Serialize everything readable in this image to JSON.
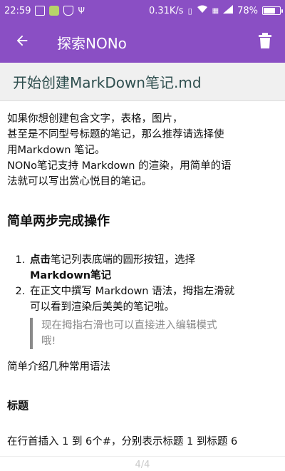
{
  "status_bar": {
    "time": "22:59",
    "speed": "0.31K/s",
    "battery_percent": "78%",
    "battery_level": 0.78
  },
  "app_bar": {
    "title": "探索NONo"
  },
  "file": {
    "title": "开始创建MarkDown笔记.md"
  },
  "content": {
    "intro_lines": [
      "如果你想创建包含文字，表格，图片，",
      "甚至是不同型号标题的笔记，那么推荐请选择使",
      "用Markdown 笔记。",
      "NONo笔记支持 Markdown 的渲染，用简单的语",
      "法就可以写出赏心悦目的笔记。"
    ],
    "heading_steps": "简单两步完成操作",
    "steps": [
      {
        "bold_prefix": "点击",
        "text": "笔记列表底端的圆形按钮，选择",
        "bold_suffix": "Markdown笔记"
      },
      {
        "text_lines": [
          "在正文中撰写 Markdown 语法，拇指左滑就",
          "可以看到渲染后美美的笔记啦。"
        ]
      }
    ],
    "quote_lines": [
      "现在拇指右滑也可以直接进入编辑模式",
      "哦!"
    ],
    "intro_syntax": "简单介绍几种常用语法",
    "heading_title": "标题",
    "title_desc": "在行首插入 1 到 6个#，分别表示标题 1 到标题 6"
  },
  "page_indicator": "4/4"
}
